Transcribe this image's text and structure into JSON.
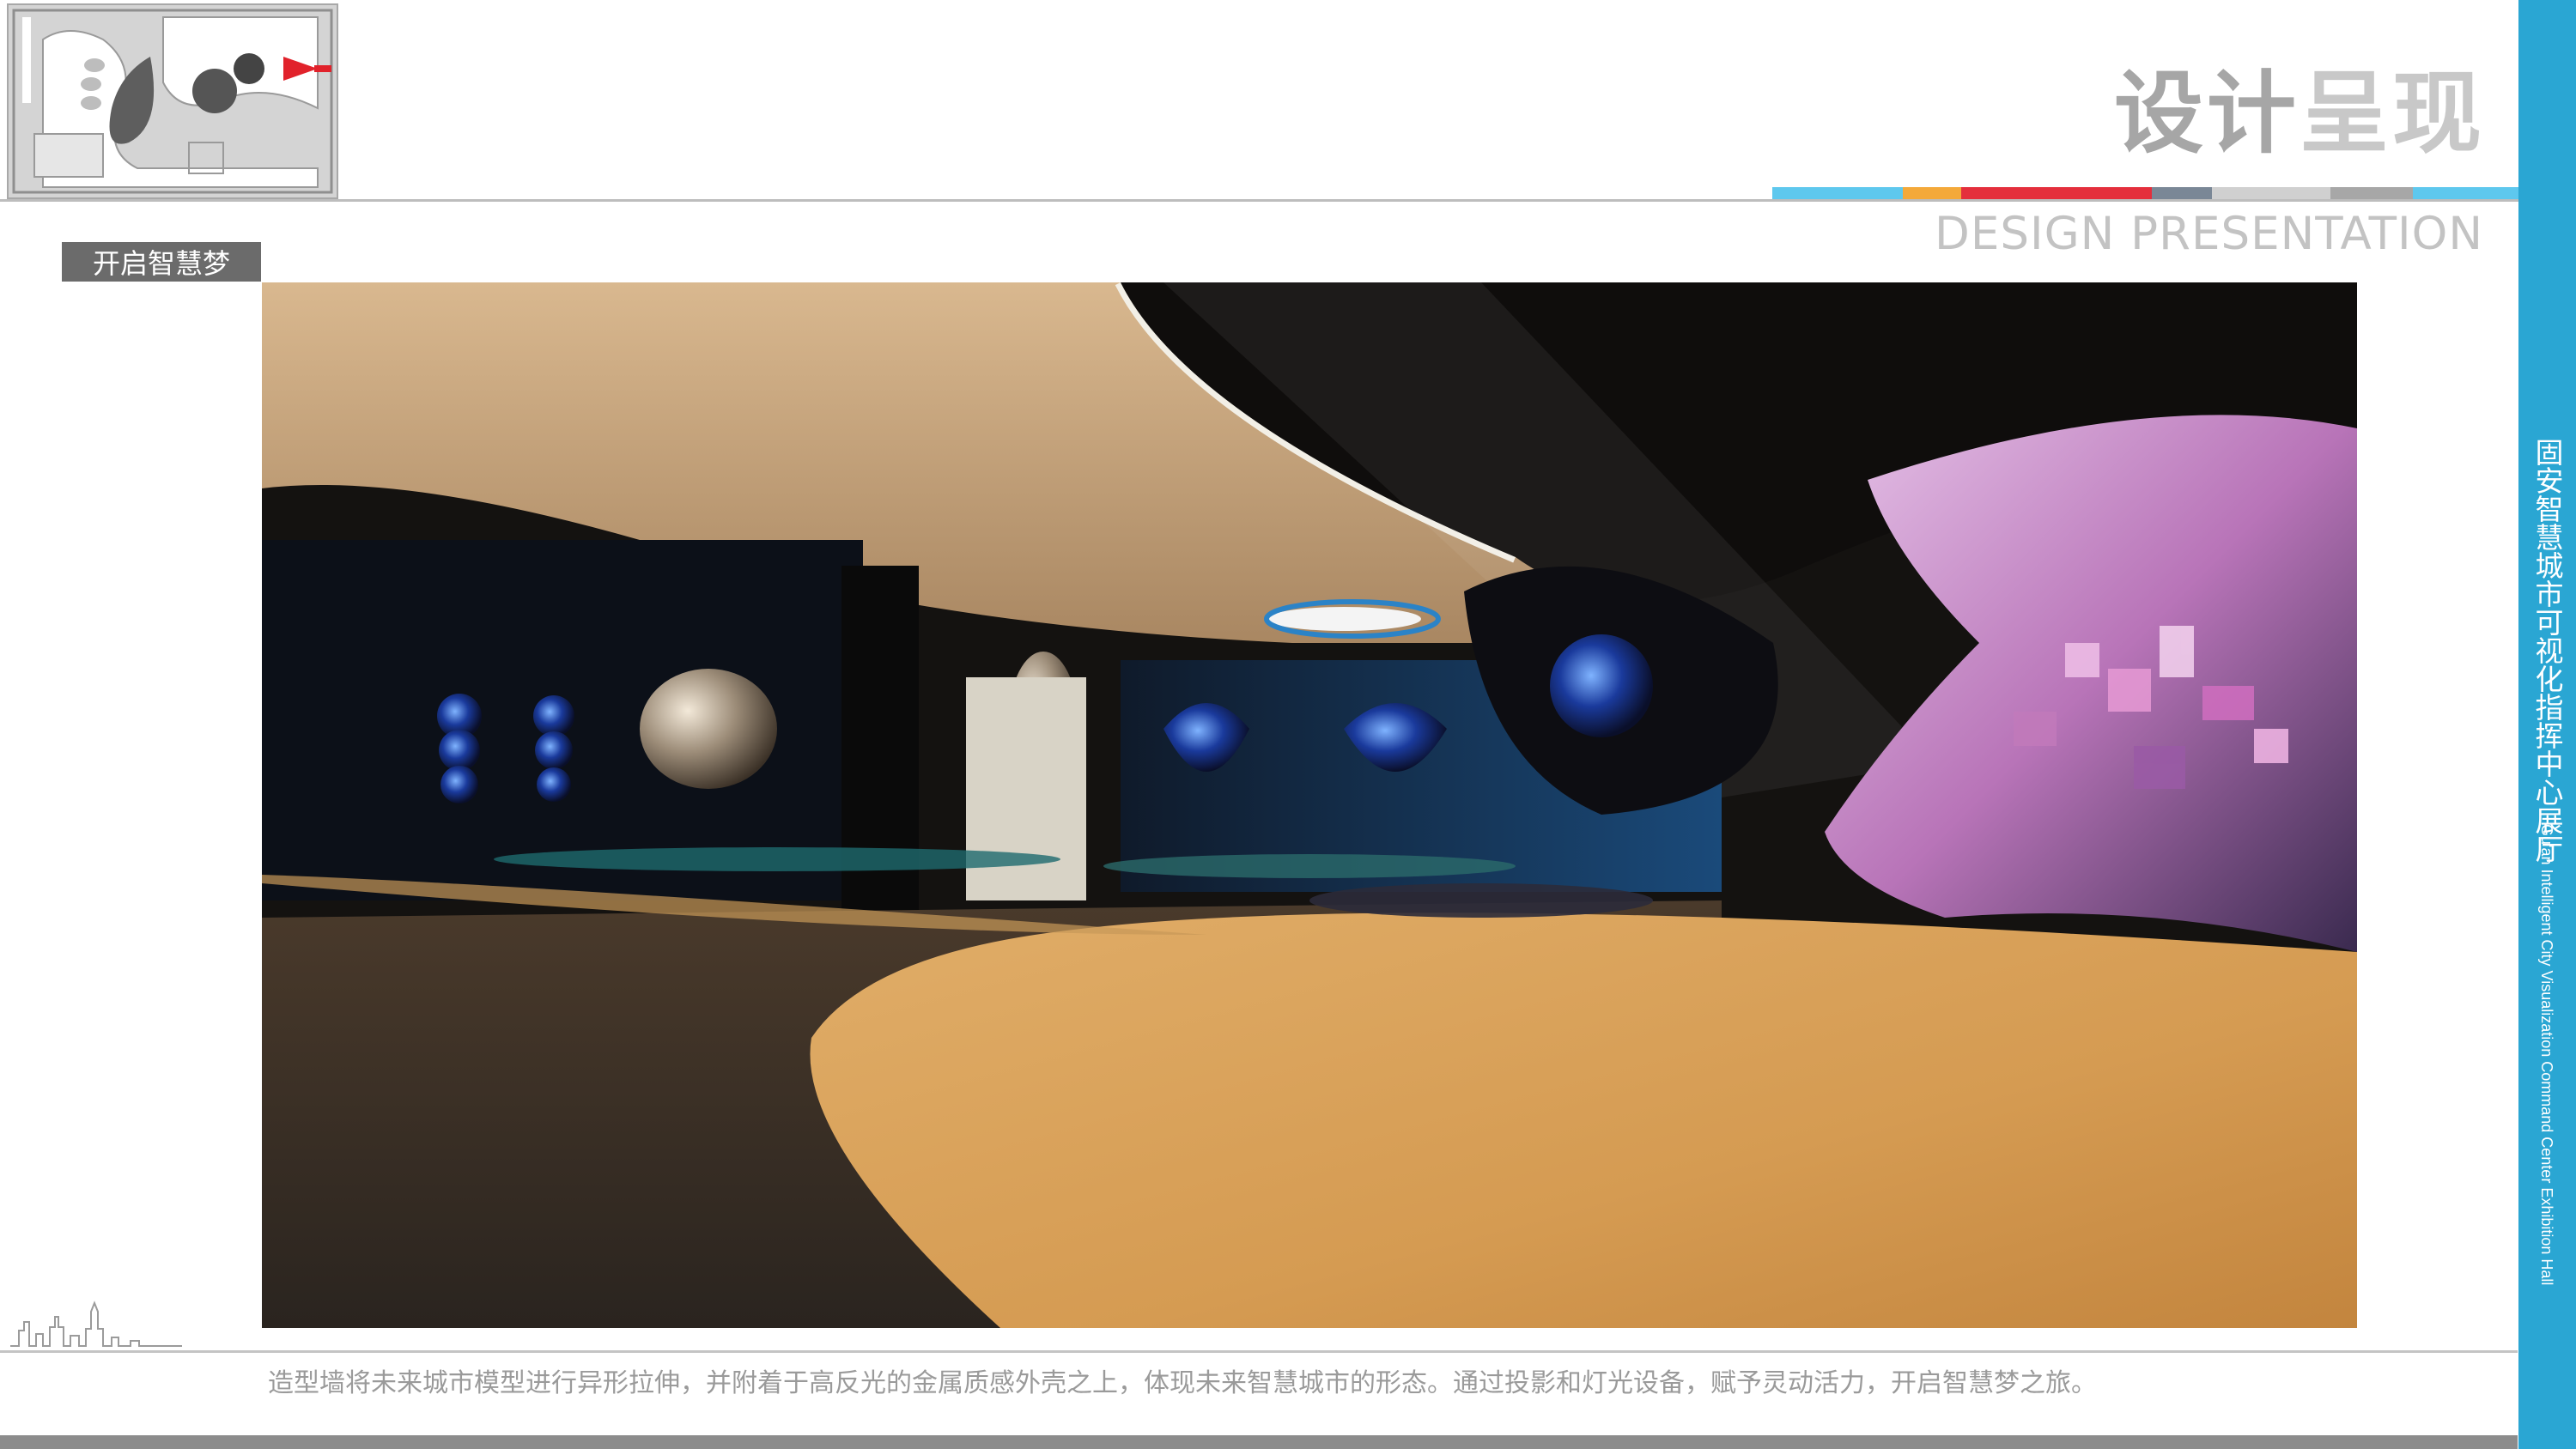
{
  "header": {
    "title_part1": "设计",
    "title_part2": "呈现",
    "subtitle_en": "DESIGN PRESENTATION",
    "color_bar": [
      "#5ec8ee",
      "#f4a93a",
      "#e42f3c",
      "#7a8796",
      "#d0d0d0",
      "#a7a7a7",
      "#5ec8ee"
    ]
  },
  "section": {
    "label": "开启智慧梦"
  },
  "side": {
    "title_cn": "固安智慧城市可视化指挥中心展厅",
    "title_en": "Gu'an Intelligent City Visualization Command Center Exhibition Hall",
    "color": "#2aa6d3"
  },
  "footer": {
    "caption": "造型墙将未来城市模型进行异形拉伸，并附着于高反光的金属质感外壳之上，体现未来智慧城市的形态。通过投影和灯光设备，赋予灵动活力，开启智慧梦之旅。"
  },
  "icons": {
    "minimap": "floor-plan-minimap",
    "skyline": "city-skyline-icon"
  }
}
